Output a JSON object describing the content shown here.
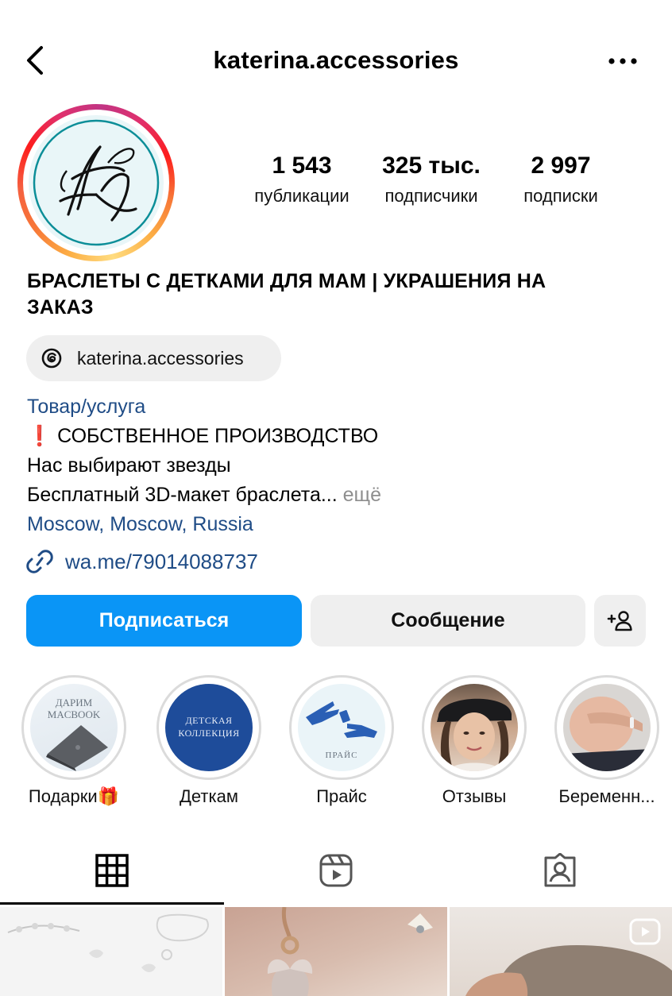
{
  "header": {
    "username": "katerina.accessories",
    "back_icon": "chevron-left-icon",
    "more_icon": "ellipsis-icon"
  },
  "profile": {
    "avatar_monogram": "KA",
    "stats": [
      {
        "value": "1 543",
        "label": "публикации"
      },
      {
        "value": "325 тыс.",
        "label": "подписчики"
      },
      {
        "value": "2 997",
        "label": "подписки"
      }
    ],
    "name_line1": "БРАСЛЕТЫ С ДЕТКАМИ ДЛЯ МАМ | УКРАШЕНИЯ НА",
    "name_line2": "ЗАКАЗ",
    "threads_handle": "katerina.accessories",
    "category": "Товар/услуга",
    "bio_line1": "❗ СОБСТВЕННОЕ ПРОИЗВОДСТВО",
    "bio_line2": "Нас выбирают звезды",
    "bio_line3": "Бесплатный 3D-макет браслета...",
    "bio_more": "ещё",
    "location": "Moscow, Moscow, Russia",
    "link": "wa.me/79014088737"
  },
  "actions": {
    "follow": "Подписаться",
    "message": "Сообщение",
    "add_user_icon": "add-person-icon"
  },
  "highlights": [
    {
      "label": "Подарки🎁",
      "image_text": "ДАРИМ MACBOOK"
    },
    {
      "label": "Деткам",
      "image_text": "ДЕТСКАЯ КОЛЛЕКЦИЯ"
    },
    {
      "label": "Прайс",
      "image_text": "ПРАЙС"
    },
    {
      "label": "Отзывы",
      "image_text": ""
    },
    {
      "label": "Беременн...",
      "image_text": ""
    }
  ],
  "tabs": [
    {
      "name": "posts",
      "icon": "grid-icon",
      "active": true
    },
    {
      "name": "reels",
      "icon": "reels-icon",
      "active": false
    },
    {
      "name": "tagged",
      "icon": "tagged-person-icon",
      "active": false
    }
  ],
  "colors": {
    "accent": "#0a95f6",
    "link": "#1f4c86",
    "button_gray": "#efefef"
  }
}
